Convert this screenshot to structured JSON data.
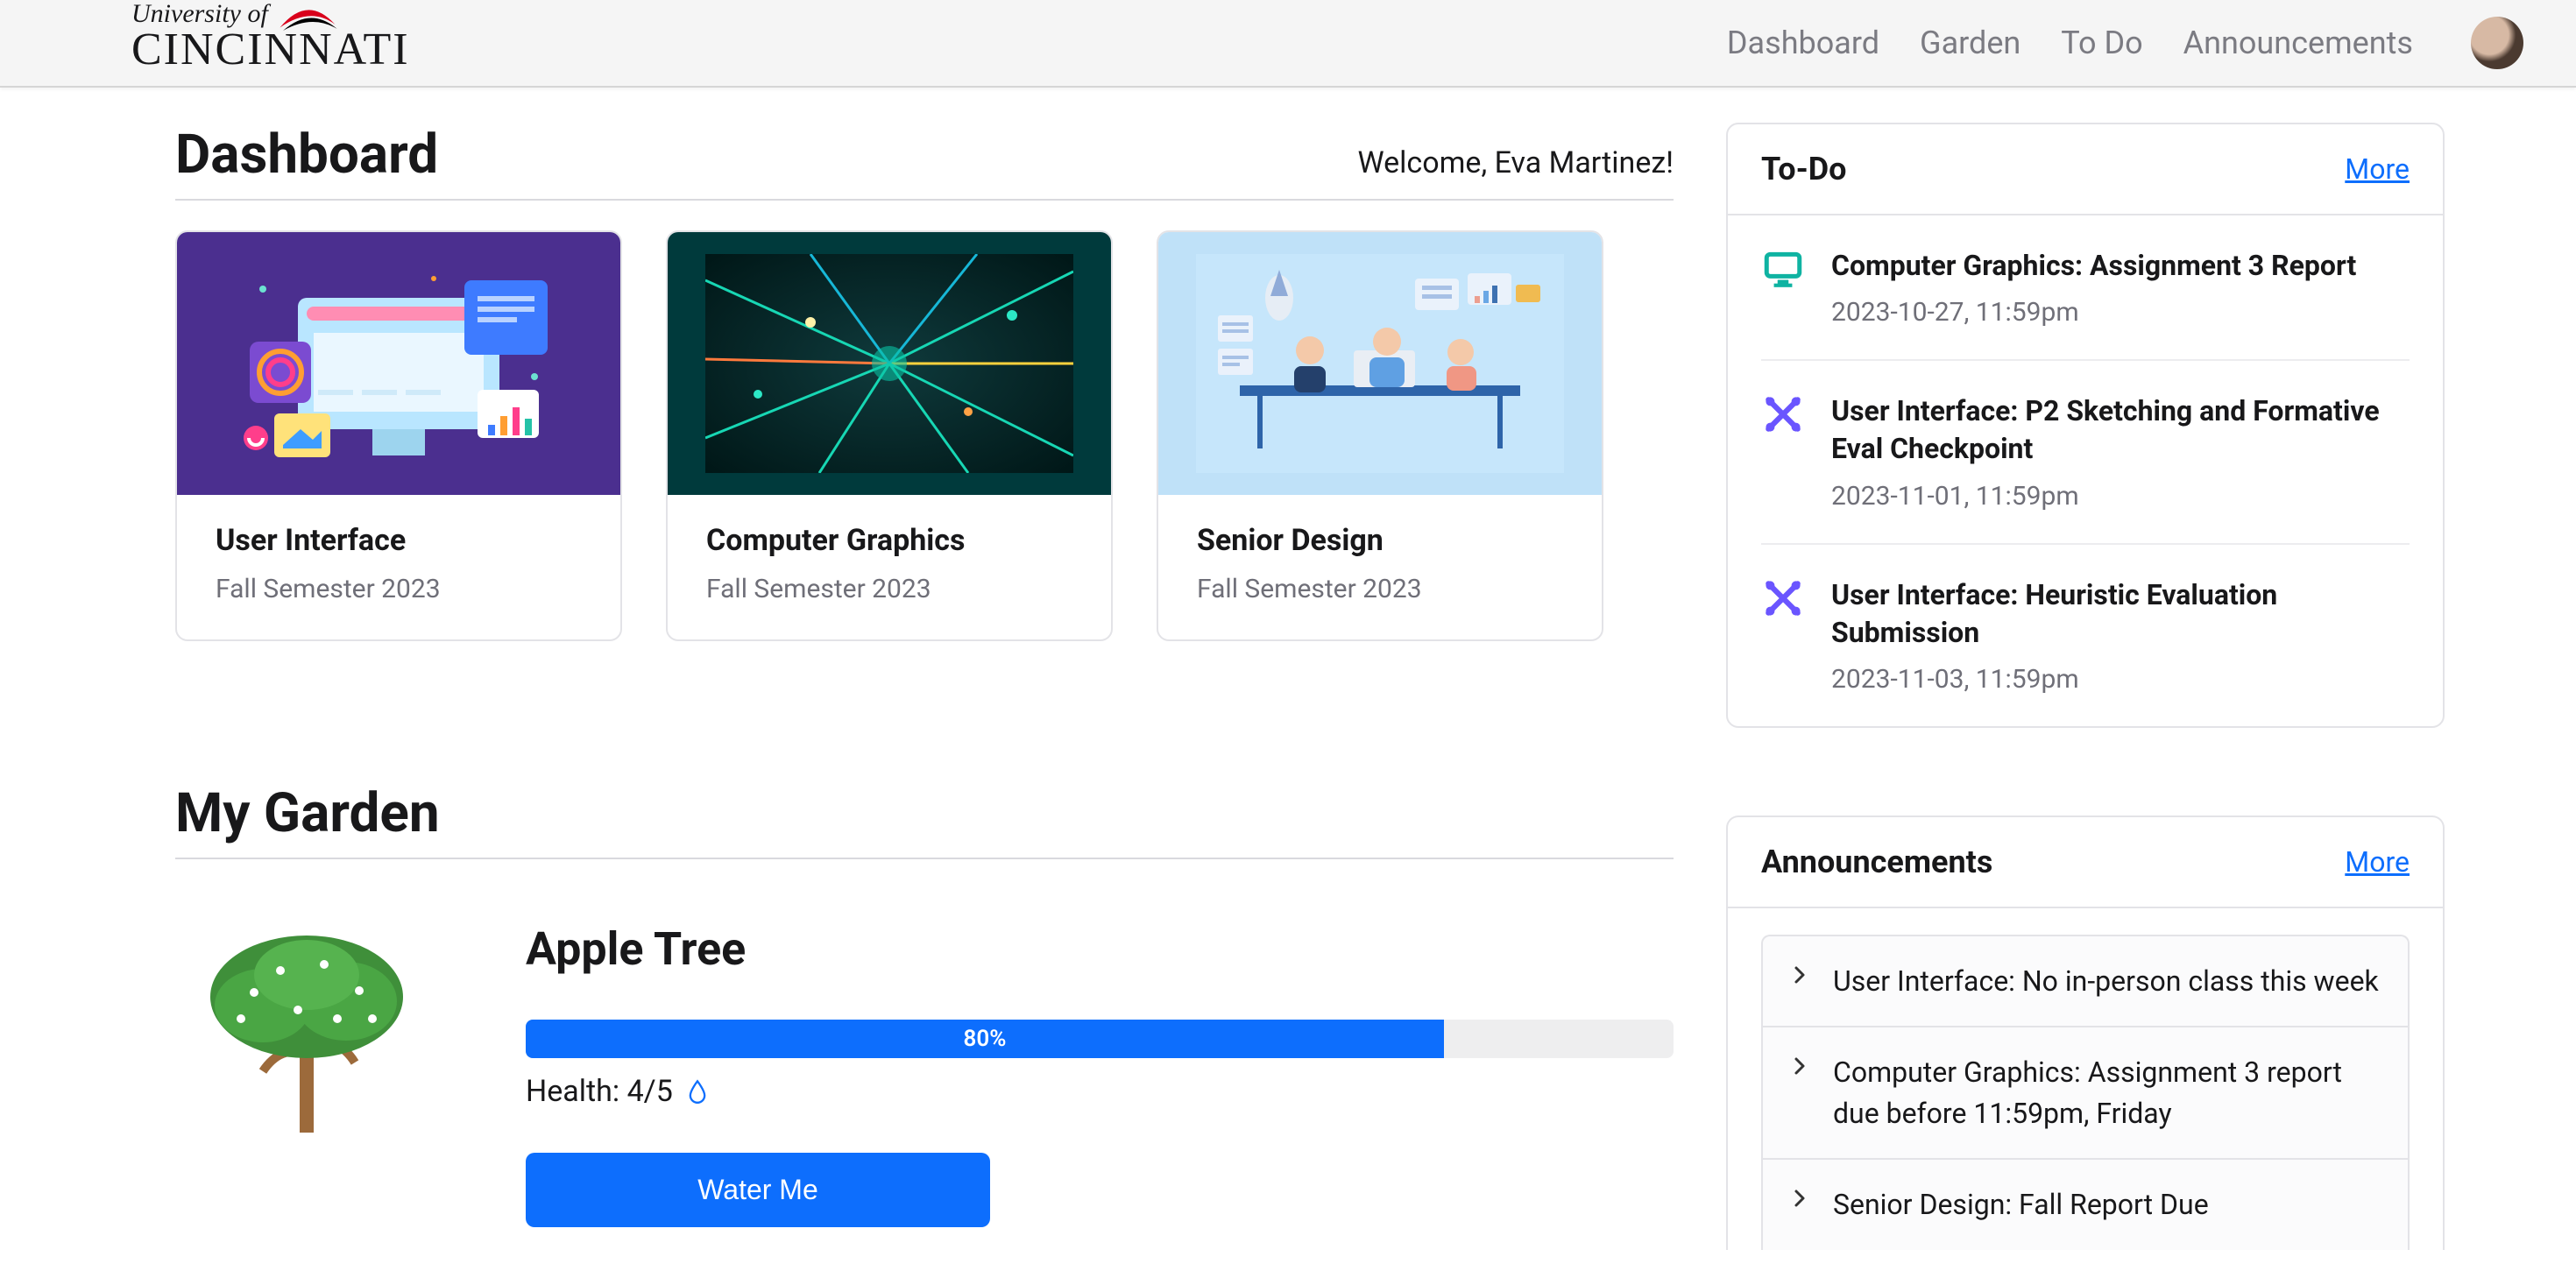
{
  "brand": {
    "top": "University of",
    "main": "CINCINNATI"
  },
  "nav": {
    "dashboard": "Dashboard",
    "garden": "Garden",
    "todo": "To Do",
    "announcements": "Announcements"
  },
  "dashboard": {
    "title": "Dashboard",
    "welcome": "Welcome, Eva Martinez!"
  },
  "courses": [
    {
      "title": "User Interface",
      "subtitle": "Fall Semester 2023"
    },
    {
      "title": "Computer Graphics",
      "subtitle": "Fall Semester 2023"
    },
    {
      "title": "Senior Design",
      "subtitle": "Fall Semester 2023"
    }
  ],
  "garden": {
    "section_title": "My Garden",
    "plant_name": "Apple Tree",
    "progress_label": "80%",
    "progress_percent": 80,
    "health_label": "Health: 4/5",
    "water_button": "Water Me"
  },
  "todo_panel": {
    "title": "To-Do",
    "more": "More",
    "items": [
      {
        "icon": "monitor",
        "title": "Computer Graphics: Assignment 3 Report",
        "date": "2023-10-27, 11:59pm"
      },
      {
        "icon": "tools",
        "title": "User Interface: P2 Sketching and Formative Eval Checkpoint",
        "date": "2023-11-01, 11:59pm"
      },
      {
        "icon": "tools",
        "title": "User Interface: Heuristic Evaluation Submission",
        "date": "2023-11-03, 11:59pm"
      }
    ]
  },
  "ann_panel": {
    "title": "Announcements",
    "more": "More",
    "items": [
      {
        "text": "User Interface: No in-person class this week"
      },
      {
        "text": "Computer Graphics: Assignment 3 report due before 11:59pm, Friday"
      },
      {
        "text": "Senior Design: Fall Report Due"
      }
    ]
  }
}
